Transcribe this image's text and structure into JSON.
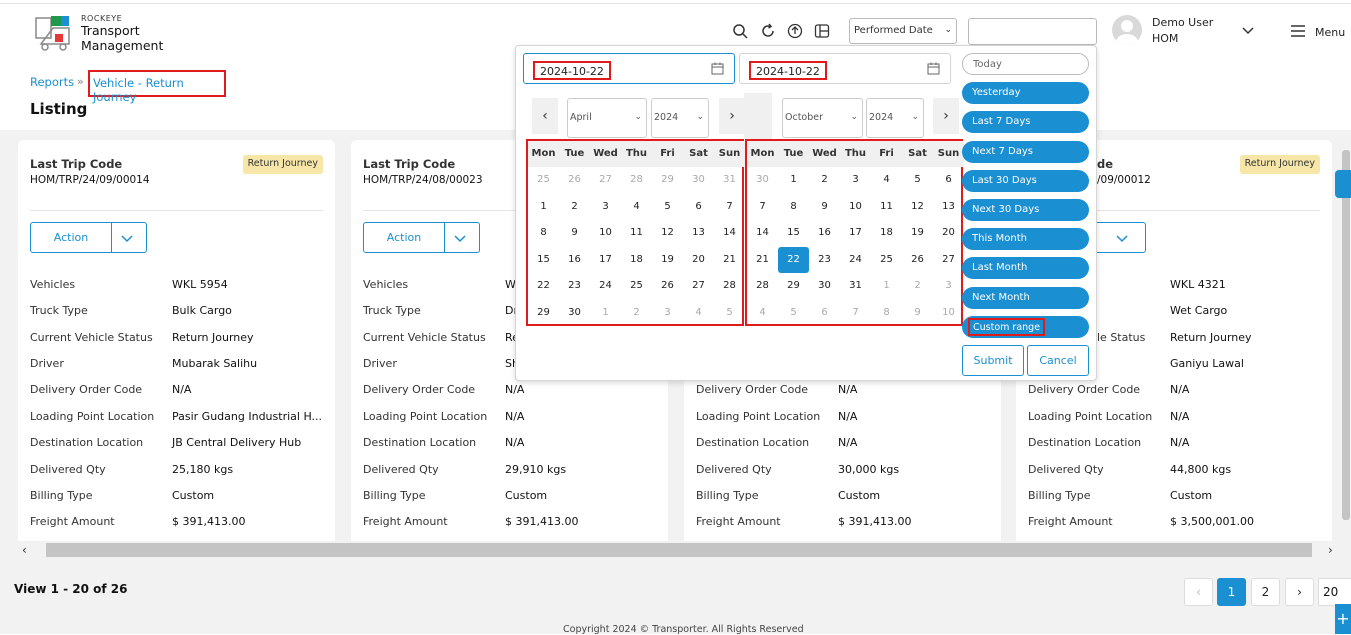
{
  "header": {
    "brand_small": "ROCKEYE",
    "brand_line1": "Transport",
    "brand_line2": "Management",
    "date_filter_select": "Performed Date",
    "user_name": "Demo User",
    "user_org": "HOM",
    "menu_label": "Menu"
  },
  "breadcrumb": {
    "reports": "Reports",
    "current": "Vehicle - Return Journey"
  },
  "page_title": "Listing",
  "cards": [
    {
      "code_label": "Last Trip Code",
      "code": "HOM/TRP/24/09/00014",
      "badge": "Return Journey",
      "action": "Action",
      "rows": [
        {
          "label": "Vehicles",
          "value": "WKL 5954"
        },
        {
          "label": "Truck Type",
          "value": "Bulk Cargo"
        },
        {
          "label": "Current Vehicle Status",
          "value": "Return Journey"
        },
        {
          "label": "Driver",
          "value": "Mubarak Salihu"
        },
        {
          "label": "Delivery Order Code",
          "value": "N/A"
        },
        {
          "label": "Loading Point Location",
          "value": "Pasir Gudang Industrial H..."
        },
        {
          "label": "Destination Location",
          "value": "JB Central Delivery Hub"
        },
        {
          "label": "Delivered Qty",
          "value": "25,180 kgs"
        },
        {
          "label": "Billing Type",
          "value": "Custom"
        },
        {
          "label": "Freight Amount",
          "value": "$ 391,413.00"
        }
      ]
    },
    {
      "code_label": "Last Trip Code",
      "code": "HOM/TRP/24/08/00023",
      "badge": "",
      "action": "Action",
      "rows": [
        {
          "label": "Vehicles",
          "value": "W"
        },
        {
          "label": "Truck Type",
          "value": "Dr"
        },
        {
          "label": "Current Vehicle Status",
          "value": "Re"
        },
        {
          "label": "Driver",
          "value": "Sh"
        },
        {
          "label": "Delivery Order Code",
          "value": "N/A"
        },
        {
          "label": "Loading Point Location",
          "value": "N/A"
        },
        {
          "label": "Destination Location",
          "value": "N/A"
        },
        {
          "label": "Delivered Qty",
          "value": "29,910 kgs"
        },
        {
          "label": "Billing Type",
          "value": "Custom"
        },
        {
          "label": "Freight Amount",
          "value": "$ 391,413.00"
        }
      ]
    },
    {
      "code_label": "",
      "code": "",
      "badge": "",
      "action": "",
      "rows": [
        {
          "label": "Delivery Order Code",
          "value": "N/A"
        },
        {
          "label": "Loading Point Location",
          "value": "N/A"
        },
        {
          "label": "Destination Location",
          "value": "N/A"
        },
        {
          "label": "Delivered Qty",
          "value": "30,000 kgs"
        },
        {
          "label": "Billing Type",
          "value": "Custom"
        },
        {
          "label": "Freight Amount",
          "value": "$ 391,413.00"
        }
      ]
    },
    {
      "code_label": "de",
      "code": "/09/00012",
      "badge": "Return Journey",
      "action": "",
      "rows": [
        {
          "label": "",
          "value": "WKL 4321"
        },
        {
          "label": "",
          "value": "Wet Cargo"
        },
        {
          "label": "le Status",
          "value": "Return Journey"
        },
        {
          "label": "",
          "value": "Ganiyu Lawal"
        },
        {
          "label": "Delivery Order Code",
          "value": "N/A"
        },
        {
          "label": "Loading Point Location",
          "value": "N/A"
        },
        {
          "label": "Destination Location",
          "value": "N/A"
        },
        {
          "label": "Delivered Qty",
          "value": "44,800 kgs"
        },
        {
          "label": "Billing Type",
          "value": "Custom"
        },
        {
          "label": "Freight Amount",
          "value": "$ 3,500,001.00"
        }
      ]
    }
  ],
  "datepicker": {
    "start_date": "2024-10-22",
    "end_date": "2024-10-22",
    "left_month": "April",
    "left_year": "2024",
    "right_month": "October",
    "right_year": "2024",
    "weekdays": [
      "Mon",
      "Tue",
      "Wed",
      "Thu",
      "Fri",
      "Sat",
      "Sun"
    ],
    "left_days": [
      [
        "25",
        "26",
        "27",
        "28",
        "29",
        "30",
        "31"
      ],
      [
        "1",
        "2",
        "3",
        "4",
        "5",
        "6",
        "7"
      ],
      [
        "8",
        "9",
        "10",
        "11",
        "12",
        "13",
        "14"
      ],
      [
        "15",
        "16",
        "17",
        "18",
        "19",
        "20",
        "21"
      ],
      [
        "22",
        "23",
        "24",
        "25",
        "26",
        "27",
        "28"
      ],
      [
        "29",
        "30",
        "1",
        "2",
        "3",
        "4",
        "5"
      ]
    ],
    "right_days": [
      [
        "30",
        "1",
        "2",
        "3",
        "4",
        "5",
        "6"
      ],
      [
        "7",
        "8",
        "9",
        "10",
        "11",
        "12",
        "13"
      ],
      [
        "14",
        "15",
        "16",
        "17",
        "18",
        "19",
        "20"
      ],
      [
        "21",
        "22",
        "23",
        "24",
        "25",
        "26",
        "27"
      ],
      [
        "28",
        "29",
        "30",
        "31",
        "1",
        "2",
        "3"
      ],
      [
        "4",
        "5",
        "6",
        "7",
        "8",
        "9",
        "10"
      ]
    ],
    "ranges": [
      "Today",
      "Yesterday",
      "Last 7 Days",
      "Next 7 Days",
      "Last 30 Days",
      "Next 30 Days",
      "This Month",
      "Last Month",
      "Next Month",
      "Custom range"
    ],
    "submit": "Submit",
    "cancel": "Cancel"
  },
  "pagination": {
    "view_count": "View 1 - 20 of 26",
    "pages": [
      "1",
      "2"
    ],
    "page_size": "20"
  },
  "footer": {
    "copyright": "Copyright 2024 © Transporter. All Rights Reserved"
  }
}
